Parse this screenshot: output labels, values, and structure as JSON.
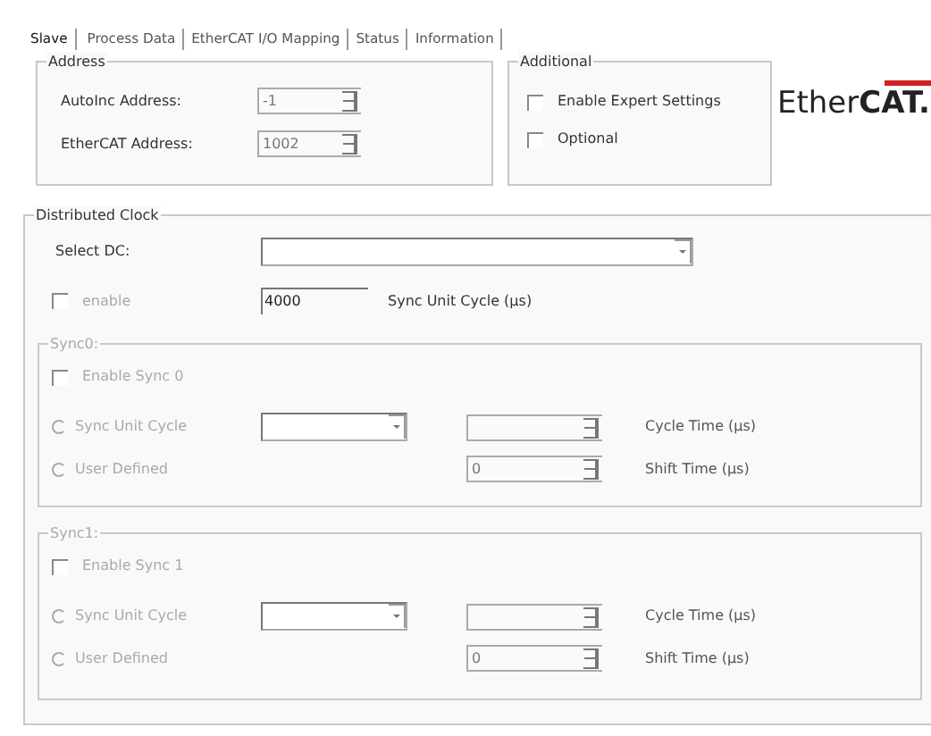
{
  "tabs": [
    {
      "label": "Slave",
      "selected": true
    },
    {
      "label": "Process Data",
      "selected": false
    },
    {
      "label": "EtherCAT I/O Mapping",
      "selected": false
    },
    {
      "label": "Status",
      "selected": false
    },
    {
      "label": "Information",
      "selected": false
    }
  ],
  "address": {
    "title": "Address",
    "fields": [
      {
        "label": "AutoInc Address:",
        "value": "-1"
      },
      {
        "label": "EtherCAT Address:",
        "value": "1002"
      }
    ]
  },
  "additional": {
    "title": "Additional",
    "options": [
      {
        "label": "Enable Expert Settings",
        "checked": false
      },
      {
        "label": "Optional",
        "checked": false
      }
    ]
  },
  "logo": {
    "light": "Ether",
    "bold": "CAT."
  },
  "distributed_clock": {
    "title": "Distributed Clock",
    "select_label": "Select DC:",
    "enable": {
      "label": "enable",
      "checked": false,
      "disabled": true
    },
    "cycle": {
      "value": "4000",
      "label": "Sync Unit Cycle (µs)"
    },
    "syncs": [
      {
        "title": "Sync0:",
        "disabled": true,
        "enable": {
          "label": "Enable Sync 0",
          "checked": false
        },
        "options": [
          {
            "kind": "dropdown",
            "label": "Sync Unit Cycle",
            "selected": false,
            "field_label": "Cycle Time (µs)"
          },
          {
            "kind": "plain",
            "label": "User Defined",
            "selected": false,
            "field_value": "0",
            "field_label": "Shift Time (µs)"
          }
        ]
      },
      {
        "title": "Sync1:",
        "disabled": true,
        "enable": {
          "label": "Enable Sync 1",
          "checked": false
        },
        "options": [
          {
            "kind": "dropdown",
            "label": "Sync Unit Cycle",
            "selected": false,
            "field_label": "Cycle Time (µs)"
          },
          {
            "kind": "plain",
            "label": "User Defined",
            "selected": false,
            "field_value": "0",
            "field_label": "Shift Time (µs)"
          }
        ]
      }
    ]
  }
}
